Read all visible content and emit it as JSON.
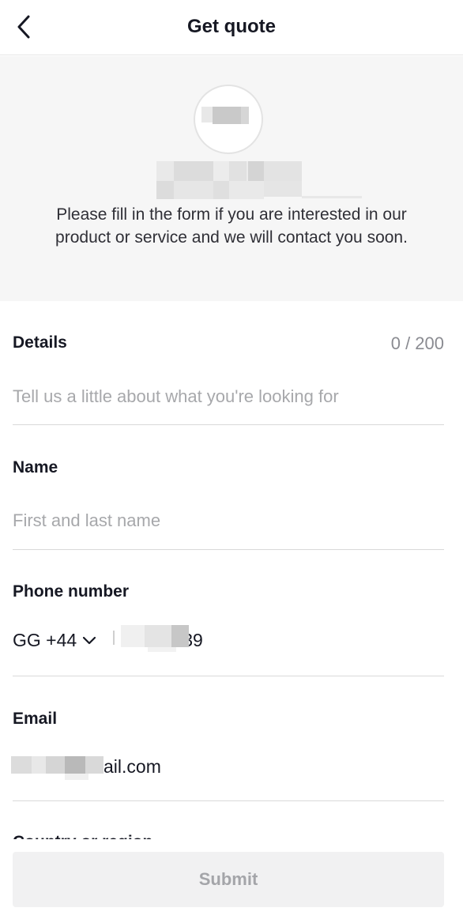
{
  "nav": {
    "title": "Get quote",
    "back_icon": "chevron-left-icon"
  },
  "header": {
    "intro": "Please fill in the form if you are interested in our product or service and we will contact you soon."
  },
  "form": {
    "details": {
      "label": "Details",
      "counter": "0 / 200",
      "value": "",
      "placeholder": "Tell us a little about what you're looking for"
    },
    "name": {
      "label": "Name",
      "value": "",
      "placeholder": "First and last name"
    },
    "phone": {
      "label": "Phone number",
      "country_code": "GG +44",
      "value_suffix": "39"
    },
    "email": {
      "label": "Email",
      "value_suffix": "ail.com"
    },
    "next_field_label": "Country or region"
  },
  "submit": {
    "label": "Submit"
  },
  "colors": {
    "header_bg": "#f6f6f6",
    "submit_bg": "#f1f1f2",
    "submit_text": "#a4a5a9",
    "divider": "#d9d9d9"
  }
}
